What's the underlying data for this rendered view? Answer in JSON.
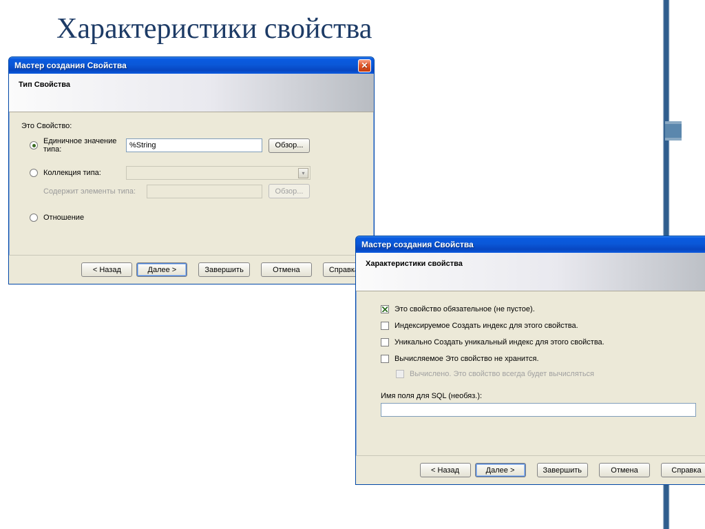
{
  "page": {
    "title": "Характеристики свойства"
  },
  "win1": {
    "title": "Мастер создания Свойства",
    "header": "Тип Свойства",
    "section": "Это Свойство:",
    "radios": {
      "single": "Единичное значение типа:",
      "collection": "Коллекция типа:",
      "contains": "Содержит элементы типа:",
      "relation": "Отношение"
    },
    "type_value": "%String",
    "browse": "Обзор...",
    "buttons": {
      "back": "< Назад",
      "next": "Далее >",
      "finish": "Завершить",
      "cancel": "Отмена",
      "help": "Справка"
    }
  },
  "win2": {
    "title": "Мастер создания Свойства",
    "header": "Характеристики свойства",
    "checks": {
      "required": "Это свойство обязательное (не пустое).",
      "indexed": "Индексируемое   Создать индекс для этого свойства.",
      "unique": "Уникально   Создать уникальный индекс для этого свойства.",
      "computed": "Вычисляемое Это свойство не хранится.",
      "always": "Вычислено. Это свойство всегда будет вычисляться"
    },
    "sql_label": "Имя поля для SQL (необяз.):",
    "buttons": {
      "back": "< Назад",
      "next": "Далее >",
      "finish": "Завершить",
      "cancel": "Отмена",
      "help": "Справка"
    }
  }
}
